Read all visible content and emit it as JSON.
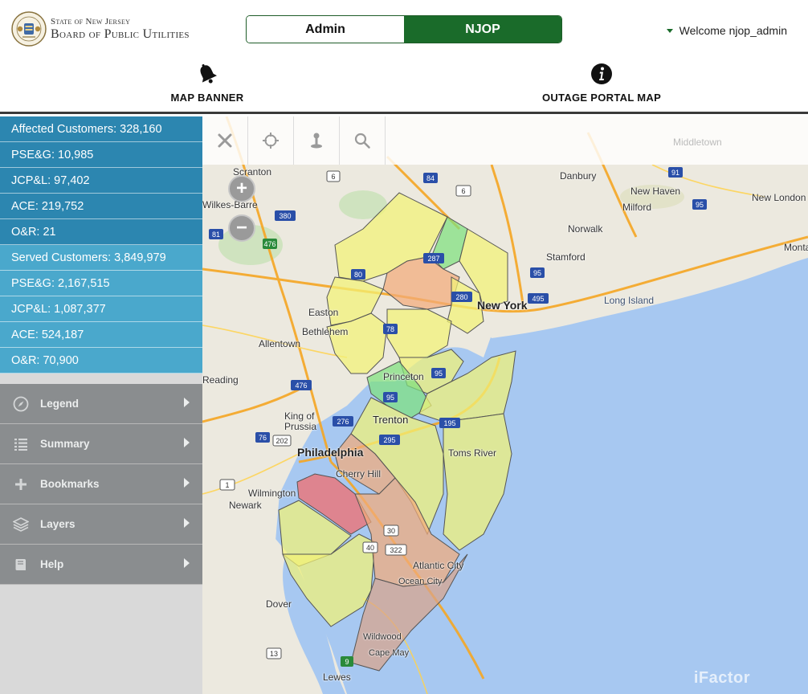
{
  "header": {
    "state_name": "State of New Jersey",
    "board_name": "Board of Public Utilities",
    "toggle": {
      "admin_label": "Admin",
      "njop_label": "NJOP",
      "active": "NJOP"
    },
    "welcome": "Welcome njop_admin",
    "nav": [
      {
        "label": "MAP BANNER",
        "icon": "bell-icon"
      },
      {
        "label": "OUTAGE PORTAL MAP",
        "icon": "info-icon"
      }
    ]
  },
  "sidebar": {
    "affected": [
      "Affected Customers: 328,160",
      "PSE&G: 10,985",
      "JCP&L: 97,402",
      "ACE: 219,752",
      "O&R: 21"
    ],
    "served": [
      "Served Customers: 3,849,979",
      "PSE&G: 2,167,515",
      "JCP&L: 1,087,377",
      "ACE: 524,187",
      "O&R: 70,900"
    ],
    "menu": [
      {
        "label": "Legend",
        "icon": "compass-icon"
      },
      {
        "label": "Summary",
        "icon": "list-icon"
      },
      {
        "label": "Bookmarks",
        "icon": "plus-icon"
      },
      {
        "label": "Layers",
        "icon": "layers-icon"
      },
      {
        "label": "Help",
        "icon": "book-icon"
      }
    ]
  },
  "map": {
    "zoom_in": "+",
    "zoom_out": "−",
    "labels": {
      "scranton": "Scranton",
      "wilkes_barre": "Wilkes-Barre",
      "danbury": "Danbury",
      "new_haven": "New Haven",
      "new_london": "New London",
      "milford": "Milford",
      "norwalk": "Norwalk",
      "stamford": "Stamford",
      "new_york": "New York",
      "long_island": "Long Island",
      "easton": "Easton",
      "bethlehem": "Bethlehem",
      "allentown": "Allentown",
      "reading": "Reading",
      "princeton": "Princeton",
      "king_of_prussia": "King of Prussia",
      "trenton": "Trenton",
      "philadelphia": "Philadelphia",
      "toms_river": "Toms River",
      "cherry_hill": "Cherry Hill",
      "wilmington": "Wilmington",
      "newark_de": "Newark",
      "atlantic_city": "Atlantic City",
      "ocean_city": "Ocean City",
      "dover": "Dover",
      "wildwood": "Wildwood",
      "cape_may": "Cape May",
      "lewes": "Lewes",
      "middletown": "Middletown",
      "montauk": "Monta"
    },
    "watermark": "iFactor"
  },
  "colors": {
    "accent_green": "#1a6b2a",
    "affected_blue": "#2c86b0",
    "served_blue": "#4aa8cc",
    "menu_gray": "#8a8d8f",
    "outage_low": "#f2f276",
    "outage_mid": "#f2aa7a",
    "outage_high": "#f46a6a",
    "outage_none": "#7ee07e"
  }
}
